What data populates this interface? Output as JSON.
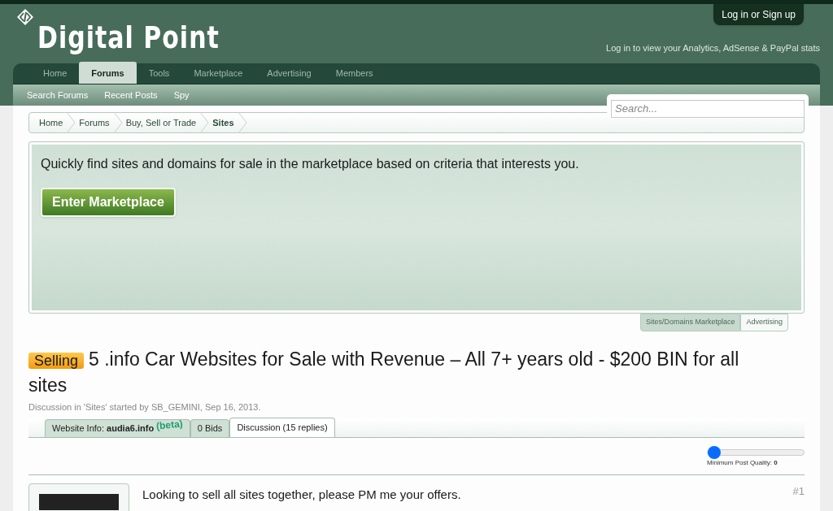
{
  "header": {
    "logo_text": "Digital Point",
    "login_button": "Log in or Sign up",
    "stats_note": "Log in to view your Analytics, AdSense & PayPal stats"
  },
  "nav_tabs": [
    {
      "label": "Home",
      "selected": false
    },
    {
      "label": "Forums",
      "selected": true
    },
    {
      "label": "Tools",
      "selected": false
    },
    {
      "label": "Marketplace",
      "selected": false
    },
    {
      "label": "Advertising",
      "selected": false
    },
    {
      "label": "Members",
      "selected": false
    }
  ],
  "sub_nav": [
    "Search Forums",
    "Recent Posts",
    "Spy"
  ],
  "search": {
    "placeholder": "Search..."
  },
  "breadcrumbs": [
    {
      "label": "Home",
      "selected": false
    },
    {
      "label": "Forums",
      "selected": false
    },
    {
      "label": "Buy, Sell or Trade",
      "selected": false
    },
    {
      "label": "Sites",
      "selected": true
    }
  ],
  "promo": {
    "text": "Quickly find sites and domains for sale in the marketplace based on criteria that interests you.",
    "button": "Enter Marketplace"
  },
  "promo_tabs": [
    {
      "label": "Sites/Domains Marketplace",
      "selected": true
    },
    {
      "label": "Advertising",
      "selected": false
    }
  ],
  "thread": {
    "prefix": "Selling",
    "title": "5 .info Car Websites for Sale with Revenue – All 7+ years old - $200 BIN for all sites",
    "meta": "Discussion in 'Sites' started by SB_GEMINI, Sep 16, 2013."
  },
  "thread_tabs": [
    {
      "label": "Website Info: **audia6.info**",
      "badge": "(beta)",
      "selected": false
    },
    {
      "label": "0 Bids",
      "selected": false
    },
    {
      "label": "Discussion (15 replies)",
      "selected": true
    }
  ],
  "quality_slider": {
    "level": 0,
    "label": "Minimum Post Quality:",
    "value": "0"
  },
  "post": {
    "text": "Looking to sell all sites together, please PM me your offers.",
    "number": "#1"
  }
}
